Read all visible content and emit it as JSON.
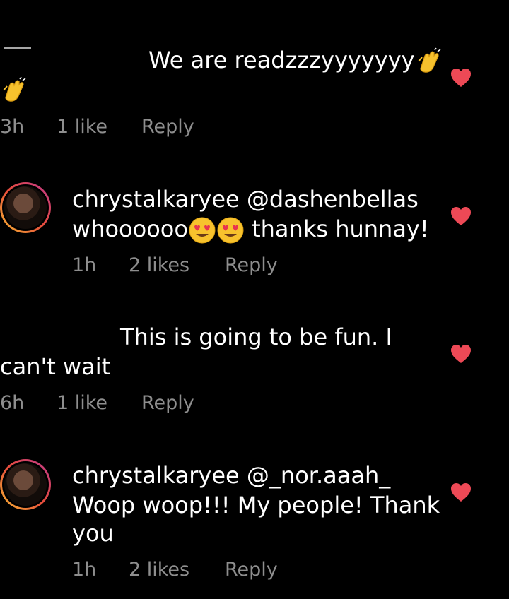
{
  "colors": {
    "background": "#000000",
    "text": "#ffffff",
    "meta": "#8e8e8e",
    "heart": "#ed4956"
  },
  "comments": [
    {
      "text_line1": "We are readzzzyyyyyyy",
      "time": "3h",
      "likes": "1 like",
      "reply": "Reply",
      "emoji": [
        "clapping-hands",
        "clapping-hands"
      ]
    },
    {
      "username": "chrystalkaryee",
      "mention": "@dashenbellas",
      "text_line2_prefix": "whoooooo",
      "text_line2_suffix": "thanks hunnay!",
      "time": "1h",
      "likes": "2 likes",
      "reply": "Reply",
      "emoji": [
        "heart-eyes-face",
        "heart-eyes-face"
      ]
    },
    {
      "text_line1": "This is going to be fun. I",
      "text_line2": "can't wait",
      "time": "6h",
      "likes": "1 like",
      "reply": "Reply"
    },
    {
      "username": "chrystalkaryee",
      "mention": "@_nor.aaah_",
      "text_line2": "Woop woop!!! My people! Thank",
      "text_line3": "you",
      "time": "1h",
      "likes": "2 likes",
      "reply": "Reply"
    }
  ]
}
